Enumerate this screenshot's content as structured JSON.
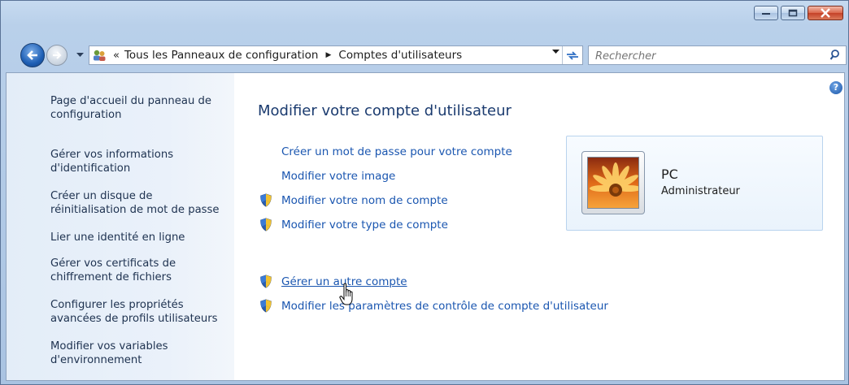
{
  "window": {
    "minimize_icon": "minimize-icon",
    "maximize_icon": "maximize-icon",
    "close_icon": "close-icon"
  },
  "navbar": {
    "back_icon": "back-arrow-icon",
    "forward_icon": "forward-arrow-icon",
    "address_prefix": "«",
    "breadcrumbs": [
      "Tous les Panneaux de configuration",
      "Comptes d'utilisateurs"
    ],
    "crumb_separator": "▶",
    "search_placeholder": "Rechercher"
  },
  "sidebar": {
    "items": [
      "Page d'accueil du panneau de configuration",
      "Gérer vos informations d'identification",
      "Créer un disque de réinitialisation de mot de passe",
      "Lier une identité en ligne",
      "Gérer vos certificats de chiffrement de fichiers",
      "Configurer les propriétés avancées de profils utilisateurs",
      "Modifier vos variables d'environnement"
    ]
  },
  "main": {
    "help_glyph": "?",
    "title": "Modifier votre compte d'utilisateur",
    "tasks": [
      {
        "label": "Créer un mot de passe pour votre compte",
        "shield": false
      },
      {
        "label": "Modifier votre image",
        "shield": false
      },
      {
        "label": "Modifier votre nom de compte",
        "shield": true
      },
      {
        "label": "Modifier votre type de compte",
        "shield": true
      },
      {
        "label": "Gérer un autre compte",
        "shield": true
      },
      {
        "label": "Modifier les paramètres de contrôle de compte d'utilisateur",
        "shield": true
      }
    ]
  },
  "user_card": {
    "name": "PC",
    "role": "Administrateur"
  },
  "colors": {
    "link": "#1a56b0",
    "title": "#1b3b6f",
    "sidebar_bg": "#e3edf8"
  }
}
